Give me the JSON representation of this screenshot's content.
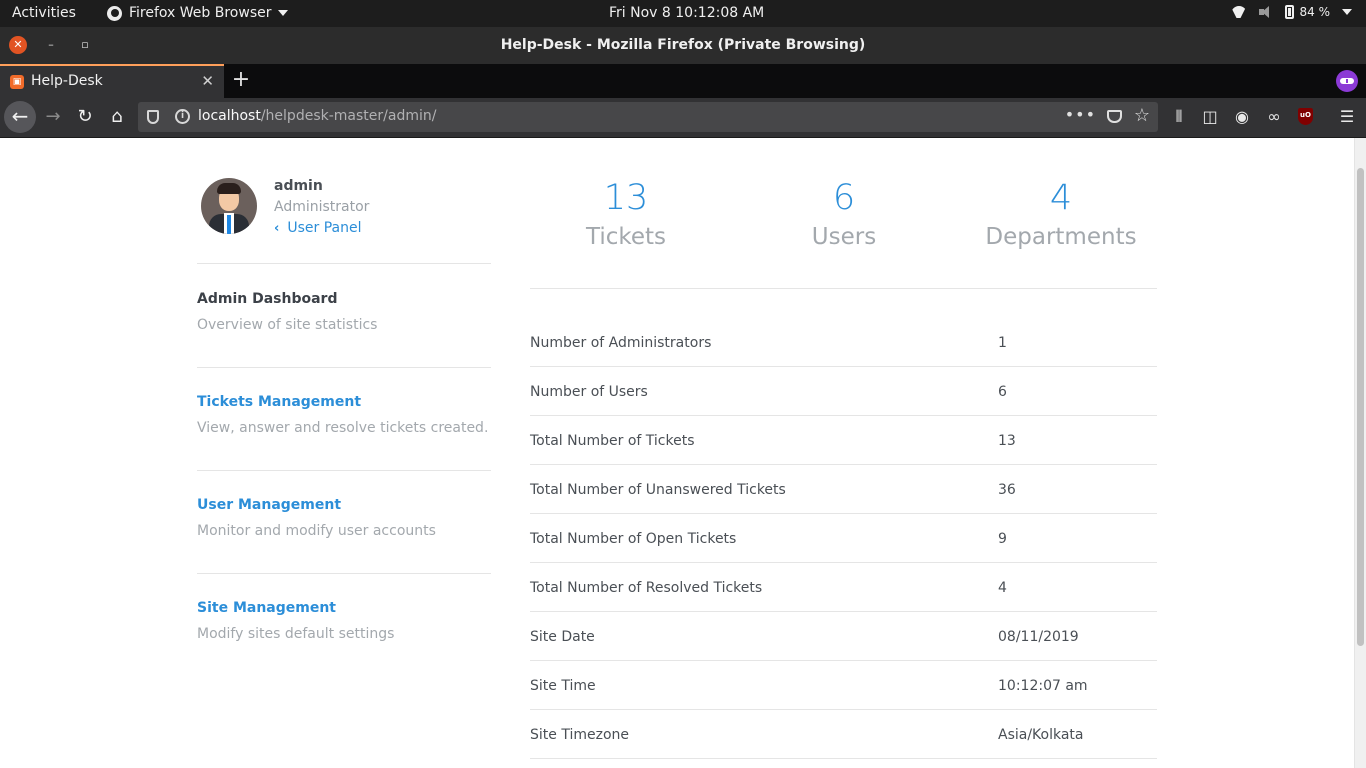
{
  "system_bar": {
    "activities": "Activities",
    "app_menu": "Firefox Web Browser",
    "clock": "Fri Nov 8  10:12:08 AM",
    "battery": "84 %"
  },
  "window": {
    "title": "Help-Desk - Mozilla Firefox (Private Browsing)"
  },
  "tabs": [
    {
      "label": "Help-Desk",
      "favicon": "helpdesk-favicon"
    }
  ],
  "address_bar": {
    "host": "localhost",
    "path": "/helpdesk-master/admin/"
  },
  "profile": {
    "name": "admin",
    "role": "Administrator",
    "panel_link": "User Panel"
  },
  "sidebar": {
    "items": [
      {
        "title": "Admin Dashboard",
        "description": "Overview of site statistics"
      },
      {
        "title": "Tickets Management",
        "description": "View, answer and resolve tickets created."
      },
      {
        "title": "User Management",
        "description": "Monitor and modify user accounts"
      },
      {
        "title": "Site Management",
        "description": "Modify sites default settings"
      }
    ]
  },
  "stats": [
    {
      "value": "13",
      "label": "Tickets"
    },
    {
      "value": "6",
      "label": "Users"
    },
    {
      "value": "4",
      "label": "Departments"
    }
  ],
  "info_rows": [
    {
      "label": "Number of Administrators",
      "value": "1"
    },
    {
      "label": "Number of Users",
      "value": "6"
    },
    {
      "label": "Total Number of Tickets",
      "value": "13"
    },
    {
      "label": "Total Number of Unanswered Tickets",
      "value": "36"
    },
    {
      "label": "Total Number of Open Tickets",
      "value": "9"
    },
    {
      "label": "Total Number of Resolved Tickets",
      "value": "4"
    },
    {
      "label": "Site Date",
      "value": "08/11/2019"
    },
    {
      "label": "Site Time",
      "value": "10:12:07 am"
    },
    {
      "label": "Site Timezone",
      "value": "Asia/Kolkata"
    }
  ],
  "colors": {
    "accent": "#2c8ed8",
    "tab_highlight": "#ff9f5a",
    "private_badge": "#8c3ad6"
  }
}
